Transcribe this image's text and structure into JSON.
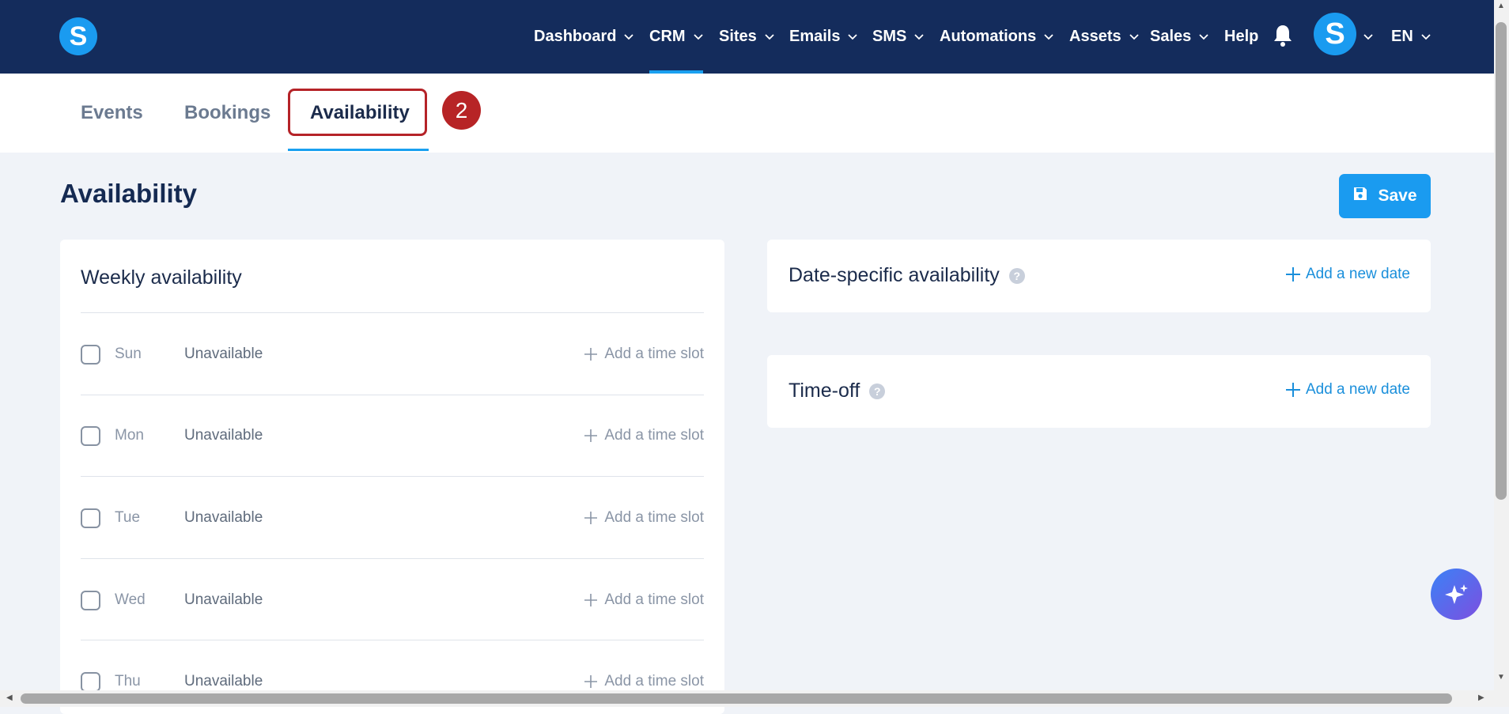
{
  "nav": {
    "logo_letter": "S",
    "items": [
      {
        "label": "Dashboard"
      },
      {
        "label": "CRM"
      },
      {
        "label": "Sites"
      },
      {
        "label": "Emails"
      },
      {
        "label": "SMS"
      },
      {
        "label": "Automations"
      },
      {
        "label": "Assets"
      },
      {
        "label": "Sales"
      },
      {
        "label": "Help"
      }
    ],
    "active_item": "CRM",
    "avatar_letter": "S",
    "language": "EN"
  },
  "tabs": [
    {
      "label": "Events"
    },
    {
      "label": "Bookings"
    },
    {
      "label": "Availability"
    }
  ],
  "active_tab": "Availability",
  "step_badge": "2",
  "page": {
    "title": "Availability",
    "save_label": "Save"
  },
  "weekly": {
    "title": "Weekly availability",
    "rows": [
      {
        "day": "Sun",
        "status": "Unavailable",
        "add_label": "Add a time slot"
      },
      {
        "day": "Mon",
        "status": "Unavailable",
        "add_label": "Add a time slot"
      },
      {
        "day": "Tue",
        "status": "Unavailable",
        "add_label": "Add a time slot"
      },
      {
        "day": "Wed",
        "status": "Unavailable",
        "add_label": "Add a time slot"
      },
      {
        "day": "Thu",
        "status": "Unavailable",
        "add_label": "Add a time slot"
      }
    ]
  },
  "date_specific": {
    "title": "Date-specific availability",
    "add_label": "Add a new date"
  },
  "time_off": {
    "title": "Time-off",
    "add_label": "Add a new date"
  },
  "colors": {
    "nav_bg": "#142c5c",
    "accent": "#1a9bf0",
    "highlight": "#b52328"
  }
}
